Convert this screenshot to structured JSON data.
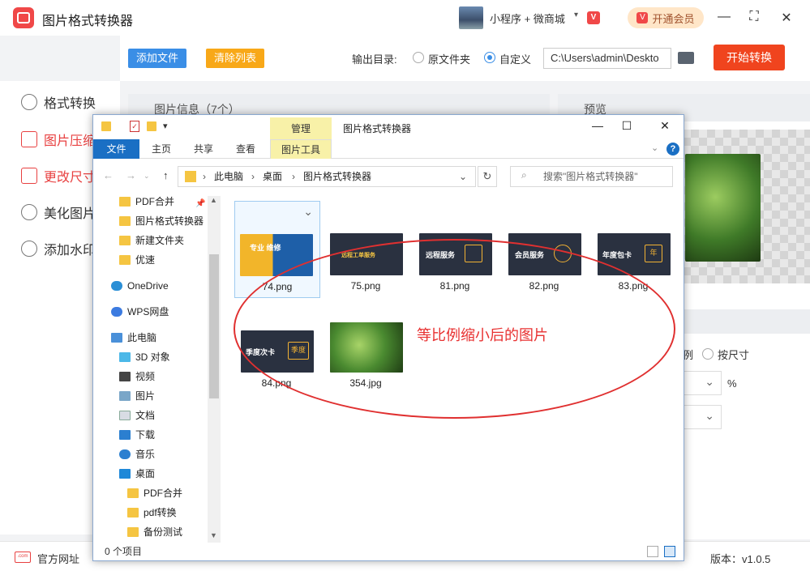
{
  "app": {
    "title": "图片格式转换器",
    "mini_program": "小程序 + 微商城",
    "mini_badge": "V",
    "vip_label": "开通会员",
    "vip_icon": "V"
  },
  "toolbar": {
    "add_files": "添加文件",
    "clear_list": "清除列表",
    "output_label": "输出目录:",
    "radio_original": "原文件夹",
    "radio_custom": "自定义",
    "output_path": "C:\\Users\\admin\\Deskto",
    "start": "开始转换"
  },
  "sidebar": {
    "items": [
      {
        "label": "格式转换",
        "icon": "convert-icon"
      },
      {
        "label": "图片压缩",
        "icon": "compress-icon"
      },
      {
        "label": "更改尺寸",
        "icon": "resize-icon"
      },
      {
        "label": "美化图片",
        "icon": "beautify-icon"
      },
      {
        "label": "添加水印",
        "icon": "watermark-icon"
      }
    ]
  },
  "panels": {
    "info_title": "图片信息（7个）",
    "preview_title": "预览",
    "settings_option_ratio": "例",
    "settings_option_size": "按尺寸",
    "percent": "%"
  },
  "footer": {
    "site_icon_text": ".com",
    "site": "官方网址",
    "version": "版本：v1.0.5"
  },
  "explorer": {
    "manage_tab": "管理",
    "window_title": "图片格式转换器",
    "ribbon_tabs": [
      "文件",
      "主页",
      "共享",
      "查看",
      "图片工具"
    ],
    "breadcrumb": [
      "此电脑",
      "桌面",
      "图片格式转换器"
    ],
    "search_placeholder": "搜索\"图片格式转换器\"",
    "tree": [
      "PDF合并",
      "图片格式转换器",
      "新建文件夹",
      "优速",
      "OneDrive",
      "WPS网盘",
      "此电脑",
      "3D 对象",
      "视频",
      "图片",
      "文档",
      "下载",
      "音乐",
      "桌面",
      "PDF合并",
      "pdf转换",
      "备份测试"
    ],
    "files": [
      {
        "name": "74.png",
        "tile": "专业 维修"
      },
      {
        "name": "75.png",
        "tile": "远程工单服务"
      },
      {
        "name": "81.png",
        "tile": "远程服务"
      },
      {
        "name": "82.png",
        "tile": "会员服务"
      },
      {
        "name": "83.png",
        "tile": "年度包卡",
        "badge": "年"
      },
      {
        "name": "84.png",
        "tile": "季度次卡",
        "badge": "季度"
      },
      {
        "name": "354.jpg",
        "tile": ""
      }
    ],
    "status": "0 个项目",
    "annotation": "等比例缩小后的图片"
  },
  "colors": {
    "accent_red": "#f0441e",
    "blue": "#3a8ee6",
    "orange": "#f8a818"
  }
}
